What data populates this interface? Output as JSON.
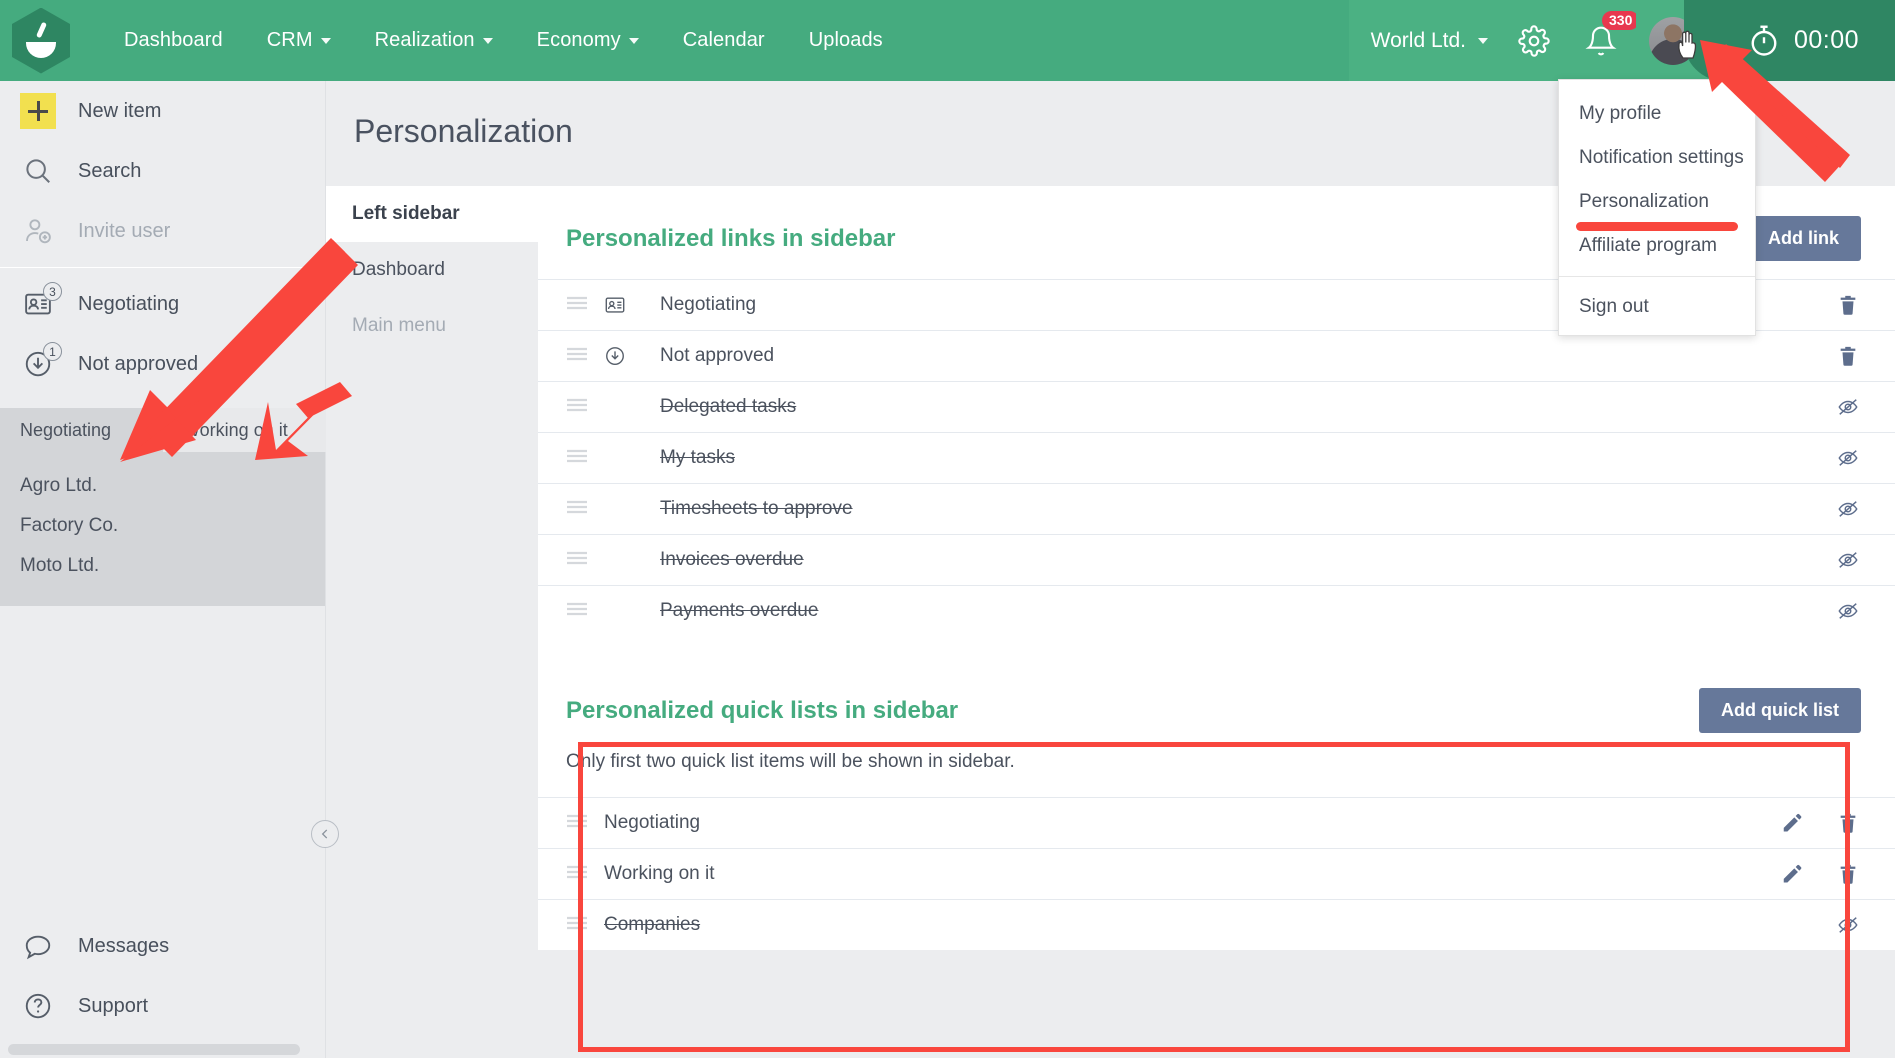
{
  "topbar": {
    "logo_name": "app-logo",
    "nav": [
      {
        "label": "Dashboard",
        "caret": false
      },
      {
        "label": "CRM",
        "caret": true
      },
      {
        "label": "Realization",
        "caret": true
      },
      {
        "label": "Economy",
        "caret": true
      },
      {
        "label": "Calendar",
        "caret": false
      },
      {
        "label": "Uploads",
        "caret": false
      }
    ],
    "org": "World Ltd.",
    "notification_count": "330",
    "timer": "00:00",
    "green": "#45ab7f",
    "green_light": "#4bb183",
    "green_dark": "#2f8663",
    "badge_red": "#e8384f"
  },
  "profile_menu": {
    "items": [
      "My profile",
      "Notification settings",
      "Personalization",
      "Affiliate program"
    ],
    "signout": "Sign out"
  },
  "sidebar": {
    "primary": [
      {
        "label": "New item",
        "icon": "plus-icon",
        "muted": false,
        "badge": null
      },
      {
        "label": "Search",
        "icon": "search-icon",
        "muted": false,
        "badge": null
      },
      {
        "label": "Invite user",
        "icon": "invite-user-icon",
        "muted": true,
        "badge": null
      }
    ],
    "links": [
      {
        "label": "Negotiating",
        "icon": "contact-card-icon",
        "badge": "3"
      },
      {
        "label": "Not approved",
        "icon": "download-circle-icon",
        "badge": "1"
      }
    ],
    "quick_tabs": [
      {
        "label": "Negotiating",
        "active": true
      },
      {
        "label": "Working on it",
        "active": false
      }
    ],
    "quick_items": [
      "Agro Ltd.",
      "Factory Co.",
      "Moto Ltd."
    ],
    "bottom": [
      {
        "label": "Messages",
        "icon": "chat-bubble-icon"
      },
      {
        "label": "Support",
        "icon": "question-circle-icon"
      }
    ]
  },
  "main": {
    "page_title": "Personalization",
    "tabs": [
      {
        "label": "Left sidebar",
        "active": true,
        "muted": false
      },
      {
        "label": "Dashboard",
        "active": false,
        "muted": false
      },
      {
        "label": "Main menu",
        "active": false,
        "muted": true
      }
    ],
    "links_section": {
      "title": "Personalized links in sidebar",
      "add_button": "Add link",
      "rows": [
        {
          "label": "Negotiating",
          "icon": "contact-card-icon",
          "struck": false,
          "action": "trash"
        },
        {
          "label": "Not approved",
          "icon": "download-circle-icon",
          "struck": false,
          "action": "trash"
        },
        {
          "label": "Delegated tasks",
          "icon": null,
          "struck": true,
          "action": "eye-off"
        },
        {
          "label": "My tasks",
          "icon": null,
          "struck": true,
          "action": "eye-off"
        },
        {
          "label": "Timesheets to approve",
          "icon": null,
          "struck": true,
          "action": "eye-off"
        },
        {
          "label": "Invoices overdue",
          "icon": null,
          "struck": true,
          "action": "eye-off"
        },
        {
          "label": "Payments overdue",
          "icon": null,
          "struck": true,
          "action": "eye-off"
        }
      ]
    },
    "quicklists_section": {
      "title": "Personalized quick lists in sidebar",
      "add_button": "Add quick list",
      "note": "Only first two quick list items will be shown in sidebar.",
      "rows": [
        {
          "label": "Negotiating",
          "struck": false,
          "actions": [
            "pencil",
            "trash"
          ]
        },
        {
          "label": "Working on it",
          "struck": false,
          "actions": [
            "pencil",
            "trash"
          ]
        },
        {
          "label": "Companies",
          "struck": true,
          "actions": [
            "eye-off"
          ]
        }
      ]
    }
  },
  "annotations": {
    "accent_red": "#f9463d"
  }
}
